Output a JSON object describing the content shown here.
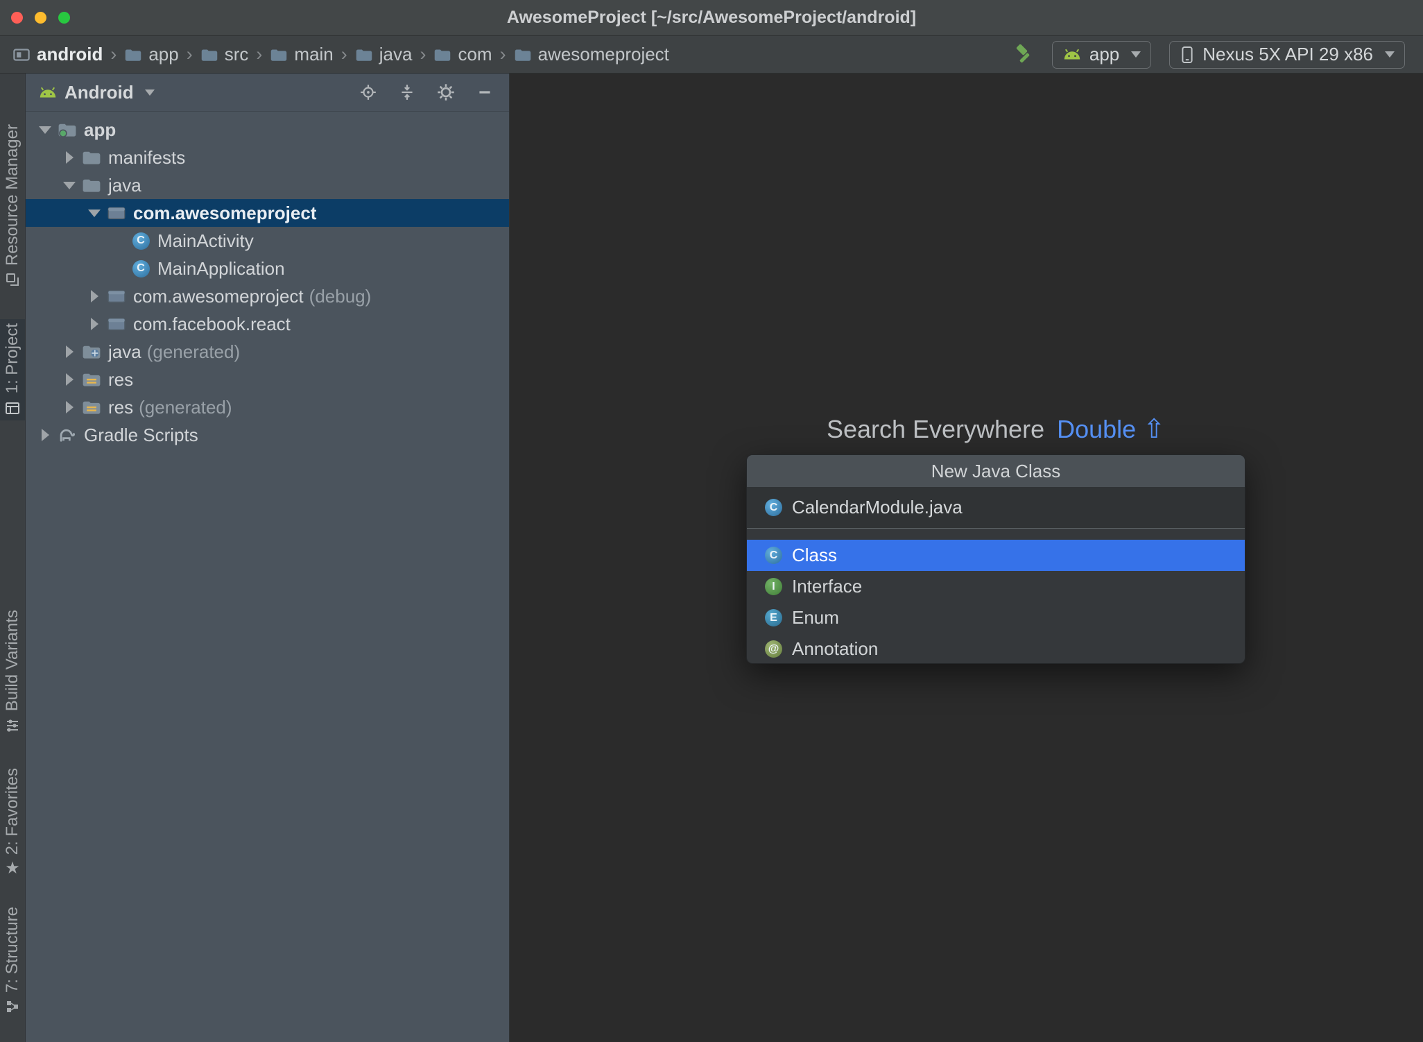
{
  "colors": {
    "popup_selection_blue": "#3672E9",
    "tree_selection_navy": "#0C3D66",
    "shortcut_link_blue": "#5691F5",
    "android_green": "#9FC546",
    "editor_background": "#2B2B2B"
  },
  "window": {
    "title": "AwesomeProject [~/src/AwesomeProject/android]"
  },
  "toolbar": {
    "breadcrumbs": [
      "android",
      "app",
      "src",
      "main",
      "java",
      "com",
      "awesomeproject"
    ],
    "run_config": "app",
    "device": "Nexus 5X API 29 x86"
  },
  "stripe": {
    "resource_manager": "Resource Manager",
    "project": "1: Project",
    "build_variants": "Build Variants",
    "favorites": "2: Favorites",
    "structure": "7: Structure"
  },
  "project_panel": {
    "view": "Android",
    "tree": [
      {
        "label": "app"
      },
      {
        "label": "manifests"
      },
      {
        "label": "java"
      },
      {
        "label": "com.awesomeproject"
      },
      {
        "label": "MainActivity"
      },
      {
        "label": "MainApplication"
      },
      {
        "label": "com.awesomeproject",
        "suffix": "(debug)"
      },
      {
        "label": "com.facebook.react"
      },
      {
        "label": "java",
        "suffix": "(generated)"
      },
      {
        "label": "res"
      },
      {
        "label": "res",
        "suffix": "(generated)"
      },
      {
        "label": "Gradle Scripts"
      }
    ]
  },
  "editor": {
    "hint": "Search Everywhere",
    "hint_action": "Double",
    "hint_key": "⇧"
  },
  "popup": {
    "title": "New Java Class",
    "name_value": "CalendarModule.java",
    "kinds": [
      {
        "label": "Class"
      },
      {
        "label": "Interface"
      },
      {
        "label": "Enum"
      },
      {
        "label": "Annotation"
      }
    ]
  },
  "icons": {
    "class_letter": "C",
    "interface_letter": "I",
    "enum_letter": "E",
    "annotation_symbol": "@",
    "favorites_star": "★"
  }
}
